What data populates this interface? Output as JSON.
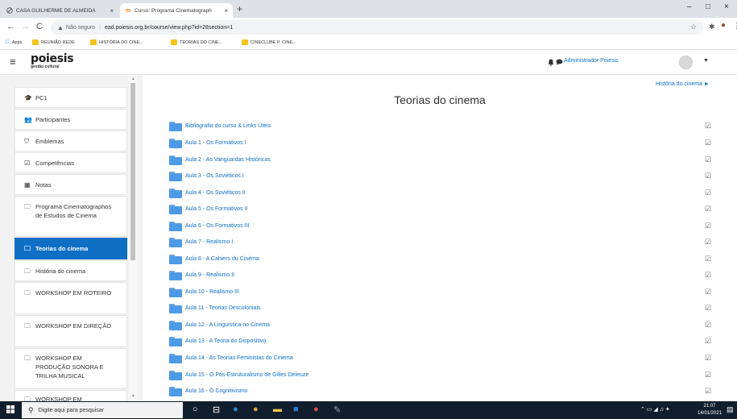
{
  "browser": {
    "tabs": [
      {
        "title": "CASA GUILHERME DE ALMEIDA",
        "icon": "globe-icon"
      },
      {
        "title": "Curso: Programa Cinematograph",
        "icon": "moodle-icon"
      }
    ],
    "new_tab": "+",
    "window": {
      "minimize": "–",
      "maximize": "□",
      "close": "×"
    },
    "nav": {
      "back": "←",
      "forward": "→",
      "reload": "C"
    },
    "address": {
      "security_warning": "Não seguro",
      "url": "ead.poiesis.org.br/course/view.php?id=28section=1"
    },
    "bookmarks": [
      {
        "label": "Apps",
        "icon": "apps-grid-icon"
      },
      {
        "label": "REUNIÃO REDE",
        "icon": "bookmark-icon"
      },
      {
        "label": "HISTÓRIA DO CINE...",
        "icon": "bookmark-icon"
      },
      {
        "label": "TEORIAS DO CINE...",
        "icon": "bookmark-icon"
      },
      {
        "label": "CINECLUBE P. CINE...",
        "icon": "bookmark-icon"
      }
    ]
  },
  "site": {
    "logo": "poiesis",
    "logo_sub": "gestão cultural",
    "user_name": "Administrador Poiesis"
  },
  "drawer": {
    "items": [
      {
        "label": "PC1",
        "icon": "graduation-cap-icon",
        "active": false
      },
      {
        "label": "Participantes",
        "icon": "users-icon",
        "active": false
      },
      {
        "label": "Emblemas",
        "icon": "shield-icon",
        "active": false
      },
      {
        "label": "Competências",
        "icon": "checkbox-icon",
        "active": false
      },
      {
        "label": "Notas",
        "icon": "table-icon",
        "active": false
      },
      {
        "label": "Programa Cinematographos de Estudos de Cinema",
        "icon": "folder-icon",
        "active": false
      },
      {
        "label": "Teorias do cinema",
        "icon": "folder-icon",
        "active": true
      },
      {
        "label": "História do cinema",
        "icon": "folder-icon",
        "active": false
      },
      {
        "label": "WORKSHOP EM ROTEIRO",
        "icon": "folder-icon",
        "active": false
      },
      {
        "label": "WORKSHOP EM DIREÇÃO",
        "icon": "folder-icon",
        "active": false
      },
      {
        "label": "WORKSHOP EM PRODUÇÃO SONORA E TRILHA MUSICAL",
        "icon": "folder-icon",
        "active": false
      },
      {
        "label": "WORKSHOP EM",
        "icon": "folder-icon",
        "active": false
      }
    ]
  },
  "main": {
    "next_section_link": "História do cinema ►",
    "section_title": "Teorias do cinema",
    "activities": [
      "Bibliografia do curso & Links Úteis",
      "Aula 1 - Os Formativos I",
      "Aula 2 - As Vanguardas Históricas",
      "Aula 3 - Os Soviéticos I",
      "Aula 4 - Os Soviéticos II",
      "Aula 5 - Os Formativos II",
      "Aula 6 - Os Formativos III",
      "Aula 7 - Realismo I",
      "Aula 8 - A Cahiers du Cinéma",
      "Aula 9 - Realismo II",
      "Aula 10 - Realismo III",
      "Aula 11 - Teorias Descoloniais",
      "Aula 12 - A Linguística no Cinema",
      "Aula 13 - A Teoria do Dispositivo",
      "Aula 14 - As Teorias Feministas do Cinema",
      "Aula 15 - O Pós-Estruturalismo de Gilles Deleuze",
      "Aula 16 - O Cognitivismo"
    ]
  },
  "taskbar": {
    "search_placeholder": "Digite aqui para pesquisar",
    "time": "21:07",
    "date": "14/01/2021"
  },
  "colors": {
    "accent": "#0f6fc5",
    "drawer_bg": "#f2f2f2",
    "taskbar_bg": "#101e2d"
  }
}
